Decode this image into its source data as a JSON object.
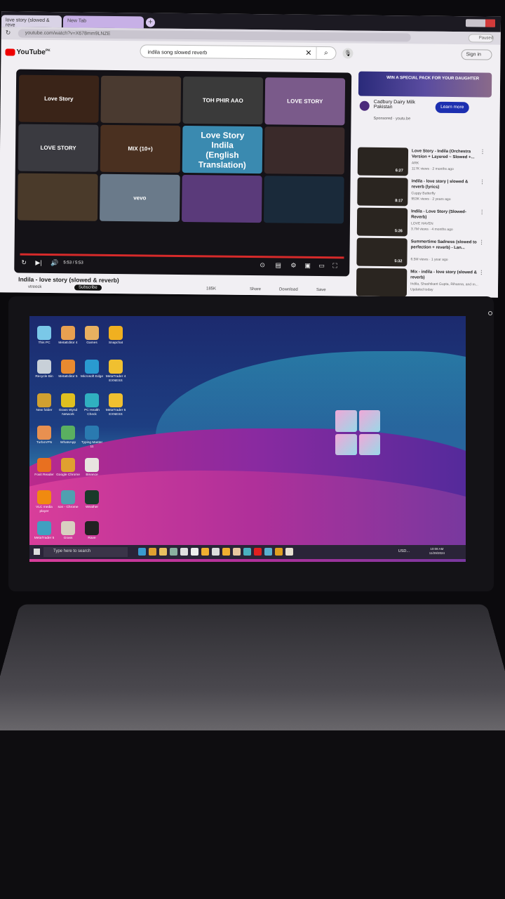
{
  "browser": {
    "tabs": [
      {
        "label": "love story (slowed & reve"
      },
      {
        "label": "New Tab"
      }
    ],
    "url": "youtube.com/watch?v=X678mm9LNZE",
    "profile_status": "Paused"
  },
  "youtube": {
    "logo": "YouTube",
    "country": "PK",
    "search_value": "indila song slowed reverb",
    "sign_in": "Sign in",
    "player": {
      "time": "5:53 / 5:53",
      "progress": 1.0,
      "thumbnails": [
        {
          "text": "Love Story",
          "color": "#3a2418"
        },
        {
          "text": "",
          "color": "#4a3a30"
        },
        {
          "text": "TOH PHIR AAO",
          "color": "#3a3a3a"
        },
        {
          "text": "LOVE STORY",
          "color": "#7a5a8a"
        },
        {
          "text": "LOVE STORY",
          "color": "#3a3a40"
        },
        {
          "text": "MIX (10+)",
          "color": "#4a3020"
        },
        {
          "text": "Love Story\nIndila\n(English Translation)",
          "color": "#3a8ab0"
        },
        {
          "text": "",
          "color": "#3a2a2a"
        },
        {
          "text": "",
          "color": "#4a3a2a"
        },
        {
          "text": "vevo",
          "color": "#6a7a8a"
        },
        {
          "text": "",
          "color": "#5a3a7a"
        },
        {
          "text": "",
          "color": "#1a2a3a"
        }
      ]
    },
    "video_title": "Indila - love story (slowed & reverb)",
    "channel": "vtreeck",
    "actions": {
      "subscribe": "Subscribe",
      "likes": "185K",
      "share": "Share",
      "download": "Download",
      "save": "Save"
    },
    "ad": {
      "banner": "WIN A SPECIAL PACK FOR YOUR DAUGHTER",
      "advertiser": "Cadbury Dairy Milk Pakistan",
      "sponsored": "Sponsored · youtu.be",
      "cta": "Learn more"
    },
    "related": [
      {
        "title": "Love Story - Indila (Orchestra Version + Layered ~ Slowed +...",
        "channel": "ARK",
        "meta": "117K views · 2 months ago",
        "duration": "6:27"
      },
      {
        "title": "indila - love story | slowed & reverb (lyrics)",
        "channel": "Cuppy Butterfly",
        "meta": "953K views · 2 years ago",
        "duration": "8:17"
      },
      {
        "title": "Indila - Love Story (Slowed-Reverb)",
        "channel": "LOVE HAVEN",
        "meta": "3.7M views · 4 months ago",
        "duration": "5:26"
      },
      {
        "title": "Summertime Sadness (slowed to perfection + reverb) - Lan...",
        "channel": "",
        "meta": "6.5M views · 1 year ago",
        "duration": "5:32"
      },
      {
        "title": "Mix - indila - love story (slowed & reverb)",
        "channel": "Indila, Shashikant Gupta, Rihanna, and m...",
        "meta": "Updated today",
        "duration": ""
      }
    ]
  },
  "desktop": {
    "icons": [
      {
        "label": "This PC",
        "color": "#7ac8e8"
      },
      {
        "label": "MetaEditor 4",
        "color": "#e8a050"
      },
      {
        "label": "Games",
        "color": "#e8b060"
      },
      {
        "label": "Snapchat",
        "color": "#f0b020"
      },
      {
        "label": "Recycle Bin",
        "color": "#c8d0d8"
      },
      {
        "label": "MetaEditor 5",
        "color": "#e88a30"
      },
      {
        "label": "Microsoft Edge",
        "color": "#2a9ad0"
      },
      {
        "label": "MetaTrader 4 EXNESS",
        "color": "#f0c030"
      },
      {
        "label": "New folder",
        "color": "#d0a030"
      },
      {
        "label": "Grass Wynd Network",
        "color": "#e0c020"
      },
      {
        "label": "PC Health Check",
        "color": "#30b0c0"
      },
      {
        "label": "MetaTrader 5 EXNESS",
        "color": "#f0c030"
      },
      {
        "label": "TurboVPN",
        "color": "#e89050"
      },
      {
        "label": "WhatsApp",
        "color": "#5ab060"
      },
      {
        "label": "Typing Master 11",
        "color": "#2a7ab0"
      },
      {
        "label": "",
        "color": ""
      },
      {
        "label": "Foxit Reader",
        "color": "#e87020"
      },
      {
        "label": "Google Chrome",
        "color": "#e0a030"
      },
      {
        "label": "Binance",
        "color": "#e8e4e0"
      },
      {
        "label": "",
        "color": ""
      },
      {
        "label": "VLC media player",
        "color": "#f08a10"
      },
      {
        "label": "son - Chrome",
        "color": "#50a0b0"
      },
      {
        "label": "Weather",
        "color": "#1a3a2a"
      },
      {
        "label": "",
        "color": ""
      },
      {
        "label": "MetaTrader 5",
        "color": "#40a0c0"
      },
      {
        "label": "Grass",
        "color": "#d8d0c0"
      },
      {
        "label": "Rave",
        "color": "#222"
      }
    ],
    "taskbar": {
      "search_placeholder": "Type here to search",
      "ticker": "USD...",
      "time": "10:08 AM",
      "date": "11/29/2024",
      "app_colors": [
        "#3a9ad0",
        "#e0a030",
        "#e8c060",
        "#8ab0a0",
        "#e0e0e0",
        "#eee",
        "#f0b030",
        "#ddd",
        "#f0b030",
        "#e8c8a0",
        "#4ab0c0",
        "#e02020",
        "#5ab0d0",
        "#e0a020",
        "#e8e0d0"
      ]
    }
  }
}
